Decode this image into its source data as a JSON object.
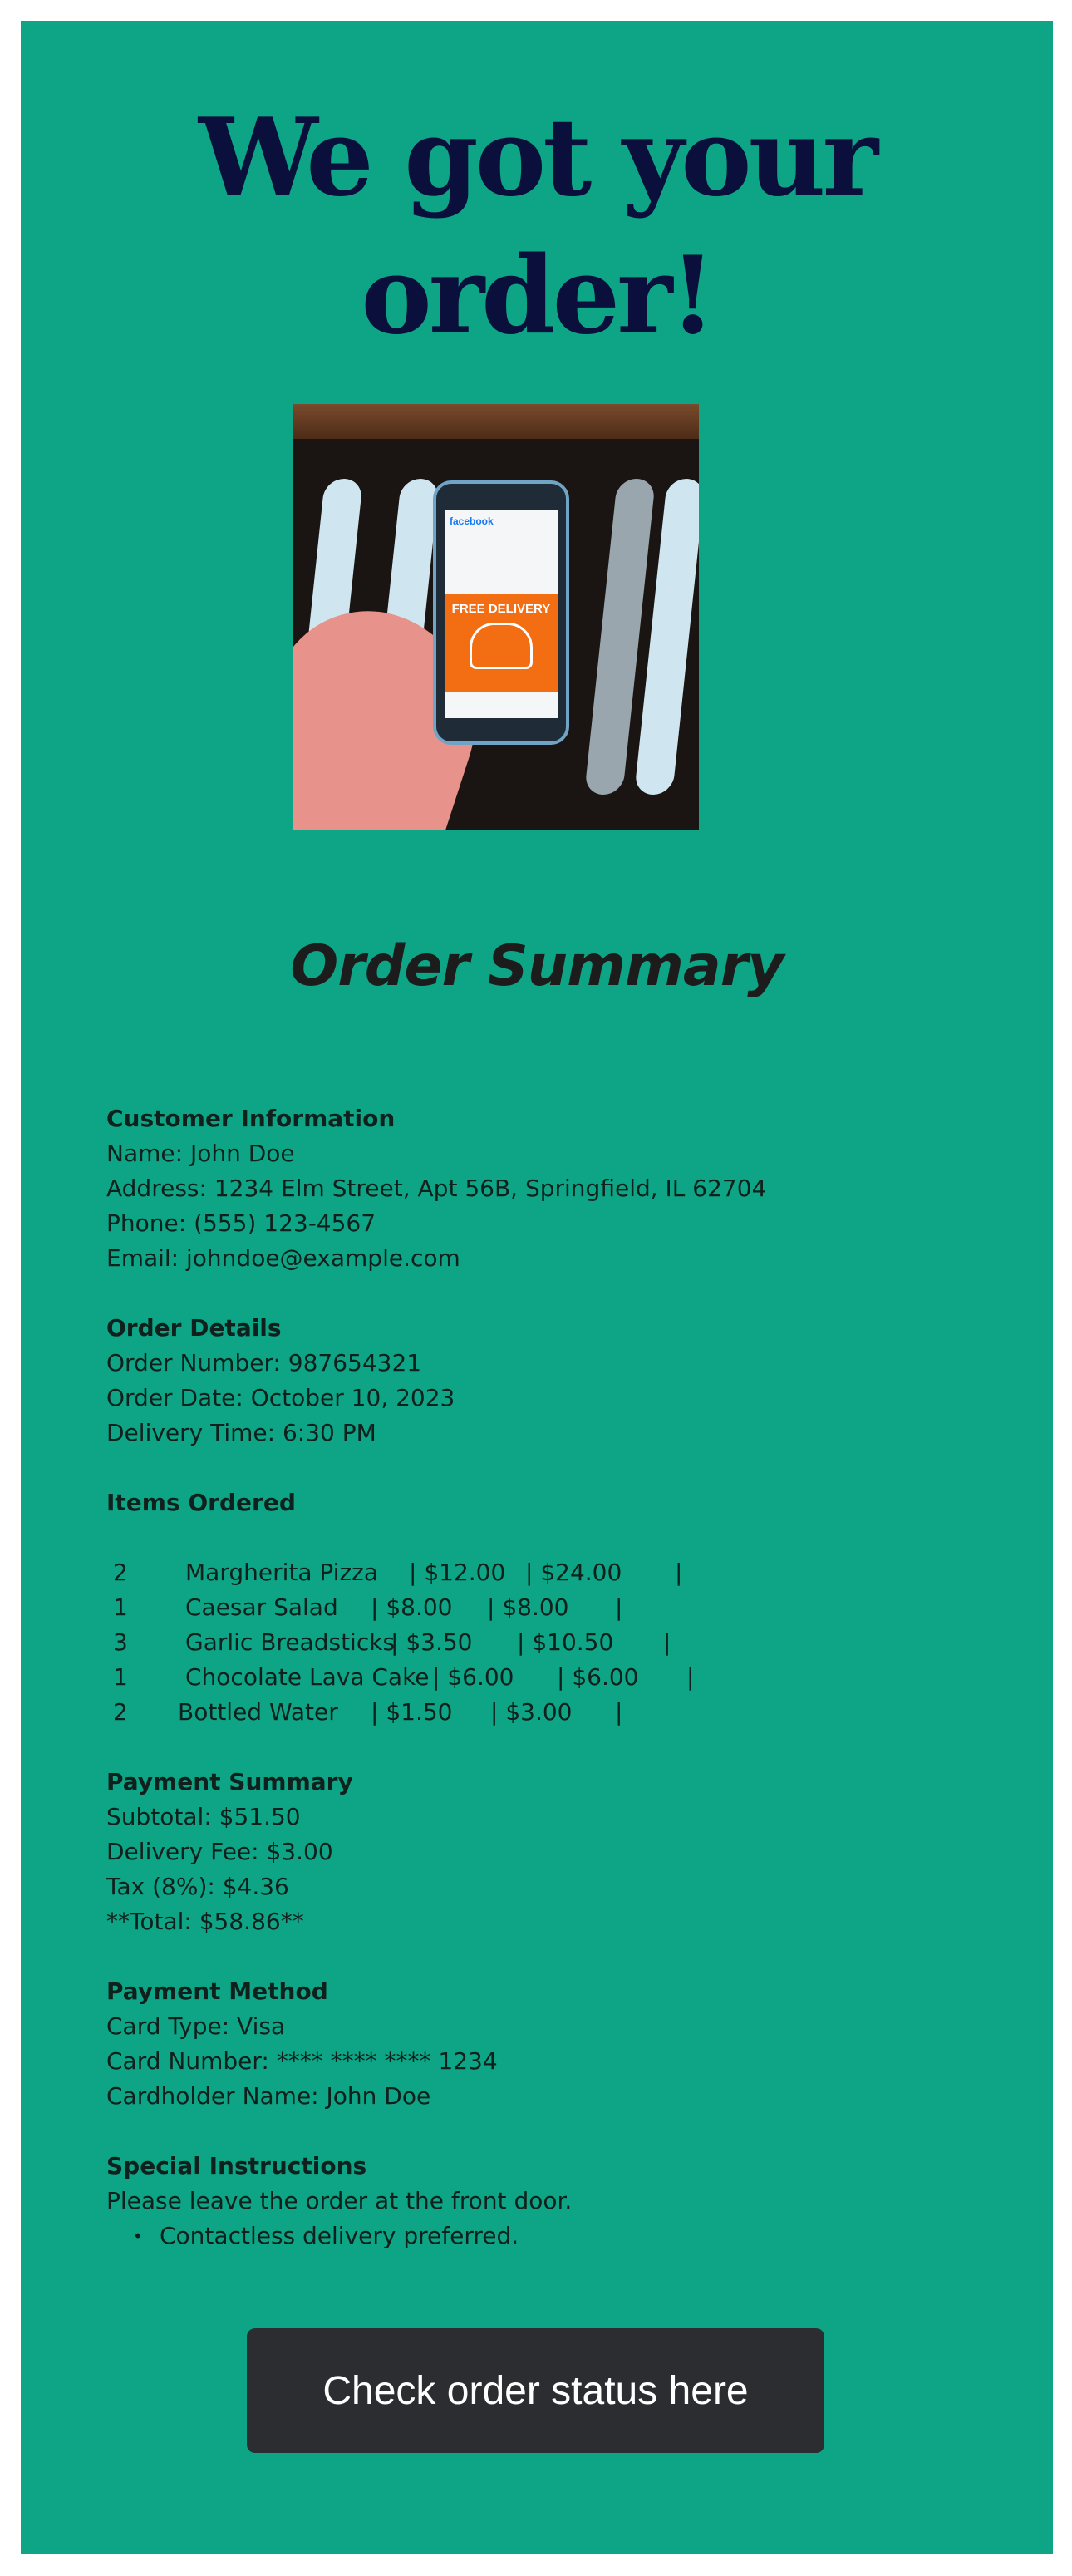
{
  "headline": "We got your order!",
  "hero_image": {
    "alt": "Phone showing Facebook with FREE DELIVERY promo",
    "brand": "facebook",
    "promo": "FREE DELIVERY"
  },
  "summary_title": "Order Summary",
  "customer": {
    "title": "Customer Information",
    "name": "Name: John Doe",
    "address": "Address: 1234 Elm Street, Apt 56B, Springfield, IL 62704",
    "phone": "Phone: (555) 123-4567",
    "email": "Email: johndoe@example.com"
  },
  "order": {
    "title": "Order Details",
    "number": "Order Number: 987654321",
    "date": "Order Date: October 10, 2023",
    "time": "Delivery Time: 6:30 PM"
  },
  "items": {
    "title": "Items Ordered",
    "rows": [
      {
        "qty": "2",
        "name": "Margherita Pizza",
        "unit": "| $12.00",
        "total": "| $24.00",
        "end": "|"
      },
      {
        "qty": "1",
        "name": "Caesar Salad",
        "unit": "| $8.00",
        "total": "| $8.00",
        "end": "|"
      },
      {
        "qty": "3",
        "name": "Garlic Breadsticks",
        "unit": "| $3.50",
        "total": "| $10.50",
        "end": "|"
      },
      {
        "qty": "1",
        "name": "Chocolate Lava Cake",
        "unit": "| $6.00",
        "total": "| $6.00",
        "end": "|"
      },
      {
        "qty": "2",
        "name": "Bottled Water",
        "unit": "| $1.50",
        "total": "| $3.00",
        "end": "|"
      }
    ]
  },
  "payment": {
    "title": "Payment Summary",
    "subtotal": "Subtotal: $51.50",
    "delivery": "Delivery Fee: $3.00",
    "tax": "Tax (8%): $4.36",
    "total": "**Total: $58.86**"
  },
  "method": {
    "title": "Payment Method",
    "card_type": "Card Type: Visa",
    "card_number": "Card Number: **** **** **** 1234",
    "holder": "Cardholder Name: John Doe"
  },
  "instructions": {
    "title": "Special Instructions",
    "line": "Please leave the order at the front door.",
    "bullet": "Contactless delivery preferred."
  },
  "cta": {
    "label": "Check order status here"
  }
}
